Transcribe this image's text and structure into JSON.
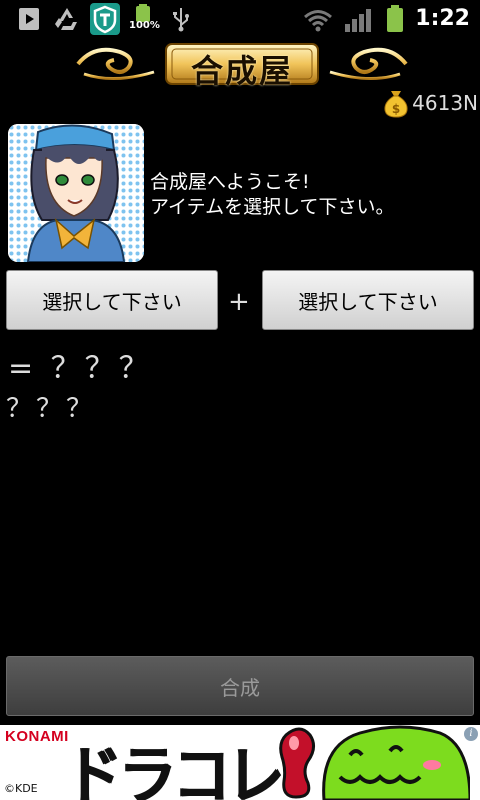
{
  "status_bar": {
    "battery_percent": "100%",
    "time": "1:22"
  },
  "header": {
    "title": "合成屋"
  },
  "money": {
    "amount": "4613N",
    "icon": "money-bag-icon"
  },
  "shopkeeper": {
    "message_line1": "合成屋へようこそ!",
    "message_line2": "アイテムを選択して下さい。"
  },
  "selection": {
    "slot1_label": "選択して下さい",
    "plus": "+",
    "slot2_label": "選択して下さい"
  },
  "result": {
    "line1": "= ？？？",
    "line2": "？？？"
  },
  "actions": {
    "combine_label": "合成"
  },
  "ad": {
    "brand": "KONAMI",
    "title": "ドラコレ",
    "copyright": "©KDE",
    "info": "i"
  },
  "colors": {
    "background": "#000000",
    "status_green": "#8bc34a",
    "button_light": "#e6e6e6",
    "button_disabled": "#4a4a4a",
    "konami_red": "#d4001f",
    "slime_green": "#7ddc1e"
  }
}
